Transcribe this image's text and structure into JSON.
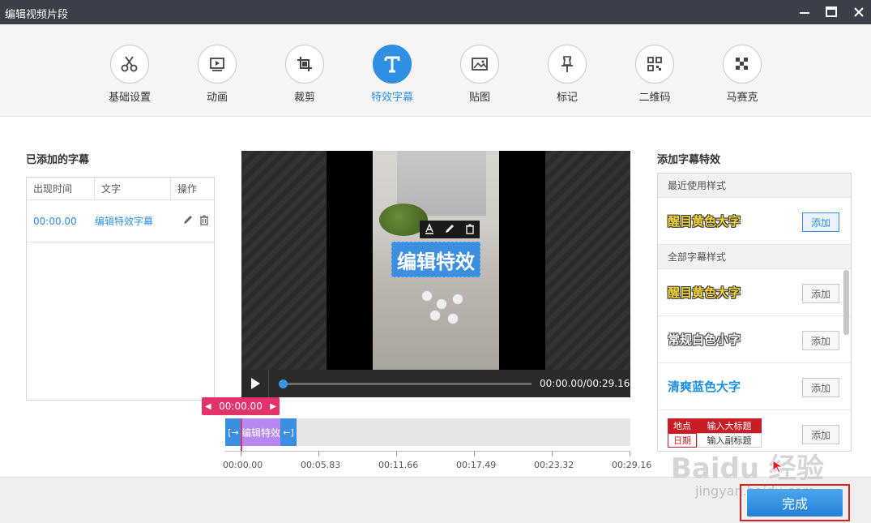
{
  "window": {
    "title": "编辑视频片段"
  },
  "toolbar": {
    "items": [
      {
        "label": "基础设置",
        "icon": "scissors-icon"
      },
      {
        "label": "动画",
        "icon": "animation-icon"
      },
      {
        "label": "裁剪",
        "icon": "crop-icon"
      },
      {
        "label": "特效字幕",
        "icon": "text-icon",
        "active": true
      },
      {
        "label": "贴图",
        "icon": "image-icon"
      },
      {
        "label": "标记",
        "icon": "pin-icon"
      },
      {
        "label": "二维码",
        "icon": "qrcode-icon"
      },
      {
        "label": "马赛克",
        "icon": "mosaic-icon"
      }
    ],
    "active_color": "#2e8fe3"
  },
  "subtitles": {
    "title": "已添加的字幕",
    "columns": [
      "出现时间",
      "文字",
      "操作"
    ],
    "rows": [
      {
        "time": "00:00.00",
        "text": "编辑特效字幕"
      }
    ]
  },
  "preview": {
    "caption_text": "编辑特效",
    "time_display": "00:00.00/00:29.16",
    "progress": 0
  },
  "timeline": {
    "current_time": "00:00.00",
    "clip_label": "编辑特效字",
    "ticks": [
      "00:00.00",
      "00:05.83",
      "00:11.66",
      "00:17.49",
      "00:23.32",
      "00:29.16"
    ]
  },
  "styles": {
    "title": "添加字幕特效",
    "recent_label": "最近使用样式",
    "all_label": "全部字幕样式",
    "recent": [
      {
        "name": "醒目黄色大字",
        "button": "添加"
      }
    ],
    "all": [
      {
        "name": "醒目黄色大字",
        "button": "添加"
      },
      {
        "name": "常规白色小字",
        "button": "添加"
      },
      {
        "name": "清爽蓝色大字",
        "button": "添加"
      }
    ],
    "table_style": {
      "cells": [
        "地点",
        "输入大标题",
        "日期",
        "输入副标题"
      ],
      "button": "添加"
    }
  },
  "footer": {
    "done_label": "完成"
  },
  "watermark": {
    "line1": "Baidu 经验",
    "line2": "jingyan.baidu.com"
  }
}
